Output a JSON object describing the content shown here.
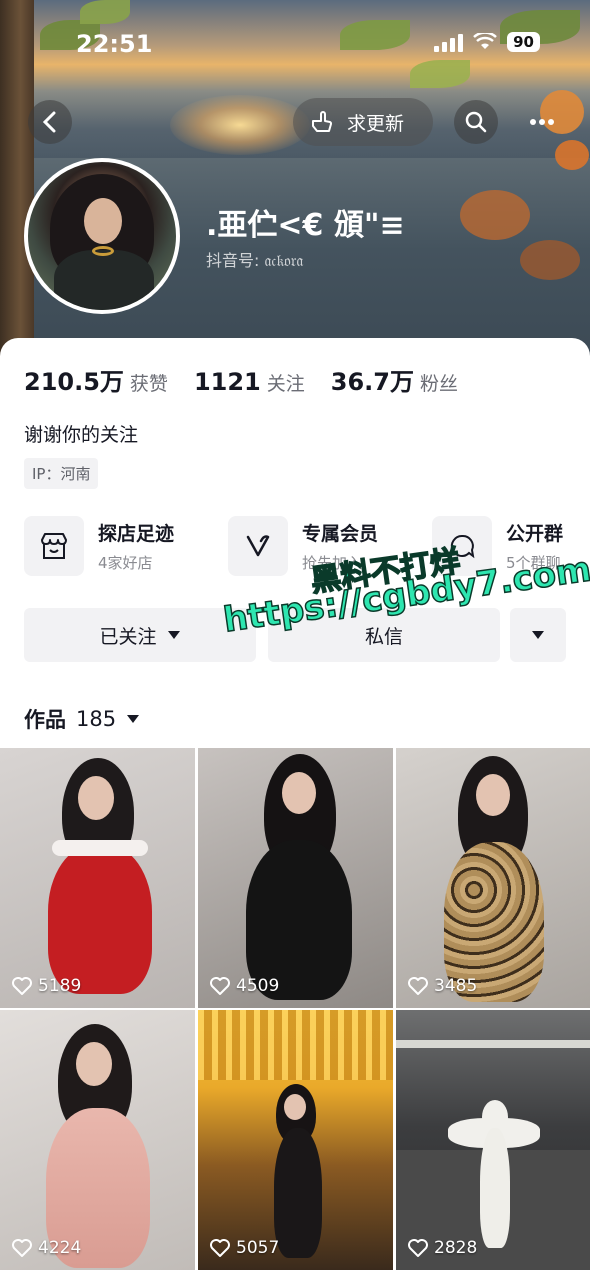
{
  "status_bar": {
    "time": "22:51",
    "battery": "90"
  },
  "header": {
    "update_label": "求更新",
    "nickname": ".亜伫<€ 頒\"≡",
    "douyin_id": "抖音号: 𝔞𝔠𝔨𝔬𝔯𝔞"
  },
  "stats": [
    {
      "num": "210.5万",
      "label": "获赞"
    },
    {
      "num": "1121",
      "label": "关注"
    },
    {
      "num": "36.7万",
      "label": "粉丝"
    }
  ],
  "bio": "谢谢你的关注",
  "ip": "IP：河南",
  "features": [
    {
      "title": "探店足迹",
      "sub": "4家好店",
      "icon": "shop-icon"
    },
    {
      "title": "专属会员",
      "sub": "抢先加入",
      "icon": "vip-icon"
    },
    {
      "title": "公开群",
      "sub": "5个群聊",
      "icon": "group-icon"
    }
  ],
  "buttons": {
    "follow": "已关注",
    "message": "私信"
  },
  "works": {
    "label": "作品",
    "count": "185"
  },
  "grid": [
    {
      "likes": "5189"
    },
    {
      "likes": "4509"
    },
    {
      "likes": "3485"
    },
    {
      "likes": "4224"
    },
    {
      "likes": "5057"
    },
    {
      "likes": "2828"
    }
  ],
  "watermark": {
    "line1": "黑料不打烊",
    "line2": "https://cgbdy7.com"
  }
}
